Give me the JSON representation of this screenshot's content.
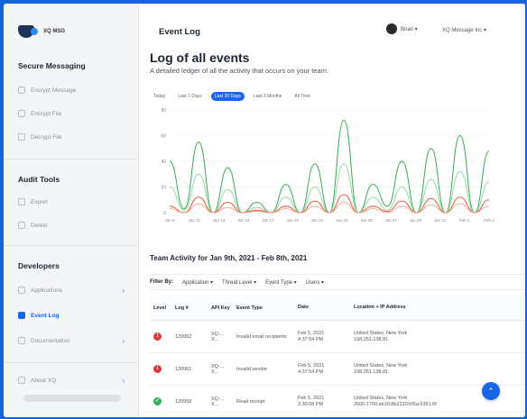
{
  "app": {
    "logo_text": "XQ MSG"
  },
  "sidebar": {
    "sections": [
      {
        "title": "Secure Messaging",
        "items": [
          {
            "label": "Encrypt Message"
          },
          {
            "label": "Encrypt File"
          },
          {
            "label": "Decrypt File"
          }
        ]
      },
      {
        "title": "Audit Tools",
        "items": [
          {
            "label": "Export"
          },
          {
            "label": "Delete"
          }
        ]
      },
      {
        "title": "Developers",
        "items": [
          {
            "label": "Applications"
          },
          {
            "label": "Event Log"
          },
          {
            "label": "Documentation"
          }
        ]
      }
    ],
    "about": "About XQ"
  },
  "header": {
    "title": "Event Log",
    "user": "Brian ▾",
    "org": "XQ Message Inc ▾"
  },
  "main": {
    "title": "Log of all events",
    "subtitle": "A detailed ledger of all the activity that occurs on your team.",
    "range_tabs": [
      "Today",
      "Last 7 Days",
      "Last 30 Days",
      "Last 3 Months",
      "All Time"
    ],
    "active_range": 2
  },
  "chart_data": {
    "type": "line",
    "x": [
      "Jan 9",
      "Jan 11",
      "Jan 13",
      "Jan 15",
      "Jan 17",
      "Jan 19",
      "Jan 21",
      "Jan 23",
      "Jan 25",
      "Jan 27",
      "Jan 29",
      "Jan 31",
      "Feb 2",
      "Feb 4"
    ],
    "ylim": [
      0,
      80
    ],
    "yticks": [
      0,
      20,
      40,
      60,
      80
    ],
    "grid": true,
    "series": [
      {
        "color": "#3aa655",
        "values": [
          40,
          3,
          55,
          0,
          35,
          0,
          8,
          0,
          22,
          0,
          38,
          0,
          72,
          0,
          22,
          5,
          40,
          0,
          50,
          0,
          60,
          0,
          48
        ]
      },
      {
        "color": "#9ad6a4",
        "values": [
          20,
          2,
          30,
          0,
          18,
          0,
          4,
          0,
          12,
          0,
          20,
          0,
          38,
          0,
          12,
          2,
          20,
          0,
          26,
          0,
          32,
          0,
          24
        ]
      },
      {
        "color": "#e0492f",
        "values": [
          5,
          0,
          12,
          0,
          8,
          0,
          2,
          0,
          5,
          0,
          9,
          0,
          14,
          0,
          5,
          1,
          9,
          0,
          11,
          0,
          12,
          0,
          10
        ]
      },
      {
        "color": "#f3a089",
        "values": [
          3,
          0,
          7,
          0,
          4,
          0,
          1,
          0,
          3,
          0,
          5,
          0,
          8,
          0,
          3,
          0,
          5,
          0,
          6,
          0,
          7,
          0,
          5
        ]
      }
    ]
  },
  "activity": {
    "title": "Team Activity for Jan 9th, 2021 - Feb 8th, 2021",
    "filter_label": "Filter By:",
    "filters": [
      "Application ▾",
      "Threat Level ▾",
      "Event Type ▾",
      "Users ▾"
    ]
  },
  "table": {
    "headers": [
      "Level",
      "Log #",
      "API Key",
      "Event Type",
      "Date",
      "Location + IP Address"
    ],
    "rows": [
      {
        "level": "error",
        "log": "120962",
        "api": "XQ-...\nX...",
        "type": "Invalid email recipients",
        "date": "Feb 5, 2021\n4:37:54 PM",
        "loc": "United States, New York\n198.251.138.81"
      },
      {
        "level": "error",
        "log": "120961",
        "api": "XQ-...\nX...",
        "type": "Invalid sender",
        "date": "Feb 5, 2021\n4:37:54 PM",
        "loc": "United States, New York\n198.251.138.81"
      },
      {
        "level": "ok",
        "log": "120958",
        "api": "XQ-...\nX...",
        "type": "Read receipt",
        "date": "Feb 5, 2021\n2:30:08 PM",
        "loc": "United States, New York\n2600:1700:ab10:8b2120:6f0a:6391:6f"
      }
    ]
  },
  "icons": {
    "fab": "chevron-up-icon"
  }
}
